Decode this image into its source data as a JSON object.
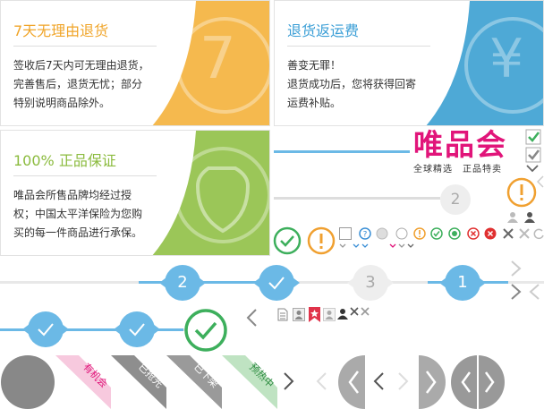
{
  "colors": {
    "orange": "#f5b94e",
    "blue": "#4ea9d6",
    "green": "#9bc658",
    "badge_blue": "#6bb9e6",
    "ok_green": "#3daf5c",
    "warn_orange": "#f0a030",
    "brand_pink": "#e1157a",
    "grey_arrow": "#999999"
  },
  "cards": [
    {
      "title": "7天无理由退货",
      "lines": [
        "签收后7天内可无理由退货，",
        "完善售后，退货无忧；部分",
        "特别说明商品除外。"
      ],
      "watermark": "7"
    },
    {
      "title": "退货返运费",
      "lines": [
        "善变无罪！",
        "退货成功后，您将获得回寄",
        "运费补贴。"
      ],
      "watermark": "¥"
    },
    {
      "title": "100% 正品保证",
      "lines": [
        "唯品会所售品牌均经过授",
        "权；中国太平洋保险为您购",
        "买的每一件商品进行承保。"
      ],
      "watermark": "shield-icon"
    }
  ],
  "brand": {
    "name": "唯品会",
    "slogan": "全球精选　正品特卖"
  },
  "steps": {
    "two": "2",
    "three": "3",
    "one": "1"
  },
  "tags": [
    "有机会",
    "已抢光",
    "已下架",
    "预热中"
  ]
}
